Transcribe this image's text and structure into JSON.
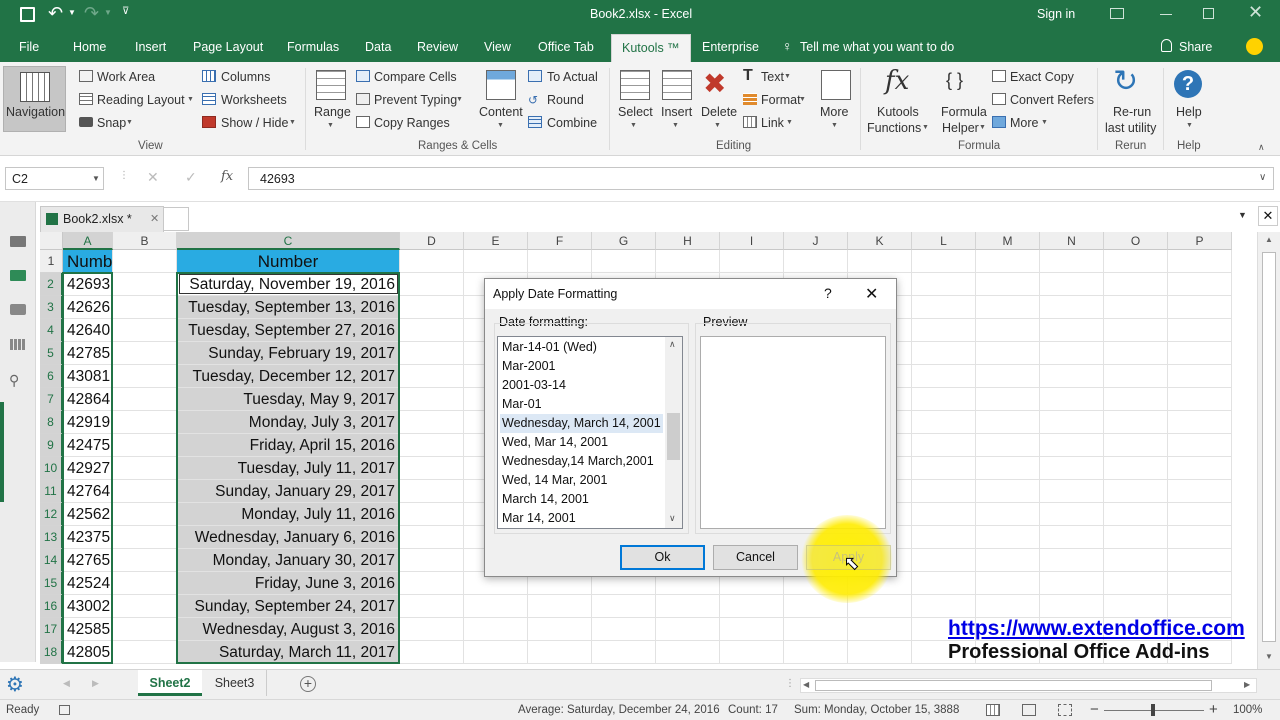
{
  "window": {
    "title": "Book2.xlsx  -  Excel",
    "signin": "Sign in"
  },
  "tabs": [
    "File",
    "Home",
    "Insert",
    "Page Layout",
    "Formulas",
    "Data",
    "Review",
    "View",
    "Office Tab",
    "Kutools ™",
    "Enterprise"
  ],
  "tell_me": "Tell me what you want to do",
  "share": "Share",
  "ribbon": {
    "navigation": "Navigation",
    "view_items": [
      "Work Area",
      "Reading Layout",
      "Snap",
      "Columns",
      "Worksheets",
      "Show / Hide"
    ],
    "view_group": "View",
    "range": "Range",
    "ranges_items": [
      "Compare Cells",
      "Prevent Typing",
      "Copy Ranges"
    ],
    "content": "Content",
    "content_items": [
      "To Actual",
      "Round",
      "Combine"
    ],
    "ranges_group": "Ranges & Cells",
    "select": "Select",
    "insert": "Insert",
    "delete": "Delete",
    "editing_items": [
      "Text",
      "Format",
      "Link"
    ],
    "more": "More",
    "editing_group": "Editing",
    "kutools_functions": [
      "Kutools",
      "Functions"
    ],
    "formula_helper": [
      "Formula",
      "Helper"
    ],
    "formula_items": [
      "Exact Copy",
      "Convert Refers",
      "More"
    ],
    "formula_group": "Formula",
    "rerun": [
      "Re-run",
      "last utility"
    ],
    "rerun_group": "Rerun",
    "help": "Help",
    "help_group": "Help"
  },
  "formula_bar": {
    "name_box": "C2",
    "fx": "fx",
    "value": "42693"
  },
  "doc_tab": "Book2.xlsx *",
  "columns": [
    "A",
    "B",
    "C",
    "D",
    "E",
    "F",
    "G",
    "H",
    "I",
    "J",
    "K",
    "L",
    "M",
    "N",
    "O",
    "P"
  ],
  "header_A": "Number",
  "header_C": "Number",
  "rows": [
    {
      "n": "1"
    },
    {
      "n": "2",
      "a": "42693",
      "c": "Saturday, November 19, 2016"
    },
    {
      "n": "3",
      "a": "42626",
      "c": "Tuesday, September 13, 2016"
    },
    {
      "n": "4",
      "a": "42640",
      "c": "Tuesday, September 27, 2016"
    },
    {
      "n": "5",
      "a": "42785",
      "c": "Sunday, February 19, 2017"
    },
    {
      "n": "6",
      "a": "43081",
      "c": "Tuesday, December 12, 2017"
    },
    {
      "n": "7",
      "a": "42864",
      "c": "Tuesday, May 9, 2017"
    },
    {
      "n": "8",
      "a": "42919",
      "c": "Monday, July 3, 2017"
    },
    {
      "n": "9",
      "a": "42475",
      "c": "Friday, April 15, 2016"
    },
    {
      "n": "10",
      "a": "42927",
      "c": "Tuesday, July 11, 2017"
    },
    {
      "n": "11",
      "a": "42764",
      "c": "Sunday, January 29, 2017"
    },
    {
      "n": "12",
      "a": "42562",
      "c": "Monday, July 11, 2016"
    },
    {
      "n": "13",
      "a": "42375",
      "c": "Wednesday, January 6, 2016"
    },
    {
      "n": "14",
      "a": "42765",
      "c": "Monday, January 30, 2017"
    },
    {
      "n": "15",
      "a": "42524",
      "c": "Friday, June 3, 2016"
    },
    {
      "n": "16",
      "a": "43002",
      "c": "Sunday, September 24, 2017"
    },
    {
      "n": "17",
      "a": "42585",
      "c": "Wednesday, August 3, 2016"
    },
    {
      "n": "18",
      "a": "42805",
      "c": "Saturday, March 11, 2017"
    }
  ],
  "dialog": {
    "title": "Apply Date Formatting",
    "help": "?",
    "date_label": "Date formatting:",
    "preview_label": "Preview",
    "formats": [
      "Mar-14-01 (Wed)",
      "Mar-2001",
      "2001-03-14",
      "Mar-01",
      "Wednesday, March 14, 2001",
      "Wed, Mar 14, 2001",
      "Wednesday,14 March,2001",
      "Wed, 14 Mar, 2001",
      "March 14, 2001",
      "Mar 14, 2001"
    ],
    "selected_index": 4,
    "ok": "Ok",
    "cancel": "Cancel",
    "apply": "Apply"
  },
  "sheets": [
    "Sheet2",
    "Sheet3"
  ],
  "active_sheet": "Sheet2",
  "status": {
    "ready": "Ready",
    "average": "Average: Saturday, December 24, 2016",
    "count": "Count: 17",
    "sum": "Sum: Monday, October 15, 3888",
    "zoom": "100%"
  },
  "watermark": {
    "url": "https://www.extendoffice.com",
    "tagline": "Professional Office Add-ins"
  },
  "colors": {
    "excel_green": "#217346",
    "header_fill": "#29abe2",
    "selection_fill": "#d3d3d3",
    "highlight": "#fff200"
  }
}
